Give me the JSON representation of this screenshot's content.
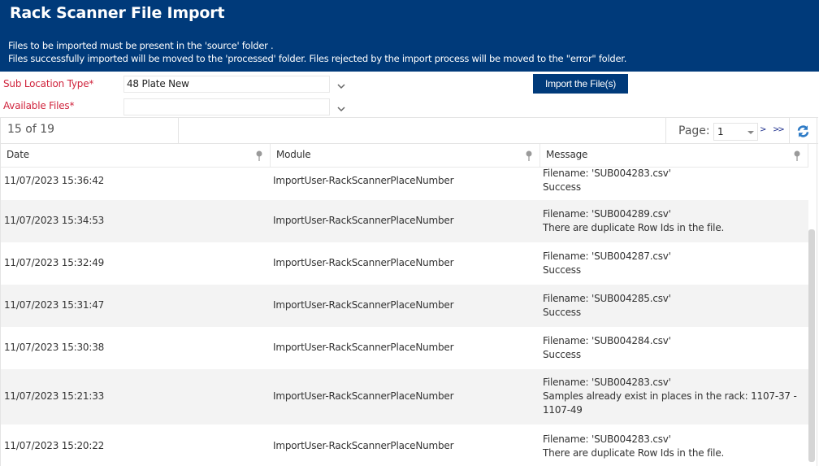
{
  "header": {
    "title": "Rack Scanner File Import",
    "info_line1": "Files to be imported must be present in the 'source' folder .",
    "info_line2": "Files successfully imported will be moved to the 'processed' folder. Files rejected by the import process will be moved to the \"error\" folder."
  },
  "form": {
    "sub_location_label": "Sub Location Type*",
    "sub_location_value": "48 Plate New",
    "available_files_label": "Available Files*",
    "available_files_value": "",
    "import_button": "Import the File(s)"
  },
  "pager": {
    "count": "15 of 19",
    "page_label": "Page:",
    "page_value": "1",
    "next": ">",
    "last": ">>"
  },
  "columns": {
    "date": "Date",
    "module": "Module",
    "message": "Message"
  },
  "rows": [
    {
      "date": "11/07/2023 15:36:42",
      "module": "ImportUser-RackScannerPlaceNumber",
      "msg1": "Filename: 'SUB004283.csv'",
      "msg2": "Success",
      "msg3": ""
    },
    {
      "date": "11/07/2023 15:34:53",
      "module": "ImportUser-RackScannerPlaceNumber",
      "msg1": "Filename: 'SUB004289.csv'",
      "msg2": "There are duplicate Row Ids in the file.",
      "msg3": ""
    },
    {
      "date": "11/07/2023 15:32:49",
      "module": "ImportUser-RackScannerPlaceNumber",
      "msg1": "Filename: 'SUB004287.csv'",
      "msg2": "Success",
      "msg3": ""
    },
    {
      "date": "11/07/2023 15:31:47",
      "module": "ImportUser-RackScannerPlaceNumber",
      "msg1": "Filename: 'SUB004285.csv'",
      "msg2": "Success",
      "msg3": ""
    },
    {
      "date": "11/07/2023 15:30:38",
      "module": "ImportUser-RackScannerPlaceNumber",
      "msg1": "Filename: 'SUB004284.csv'",
      "msg2": "Success",
      "msg3": ""
    },
    {
      "date": "11/07/2023 15:21:33",
      "module": "ImportUser-RackScannerPlaceNumber",
      "msg1": "Filename: 'SUB004283.csv'",
      "msg2": "Samples already exist in places in the rack: 1107-37 -",
      "msg3": "1107-49"
    },
    {
      "date": "11/07/2023 15:20:22",
      "module": "ImportUser-RackScannerPlaceNumber",
      "msg1": "Filename: 'SUB004283.csv'",
      "msg2": "There are duplicate Row Ids in the file.",
      "msg3": ""
    }
  ],
  "colors": {
    "brand": "#003a7a",
    "required_label": "#d0243d",
    "alt_row": "#f3f3f3"
  }
}
